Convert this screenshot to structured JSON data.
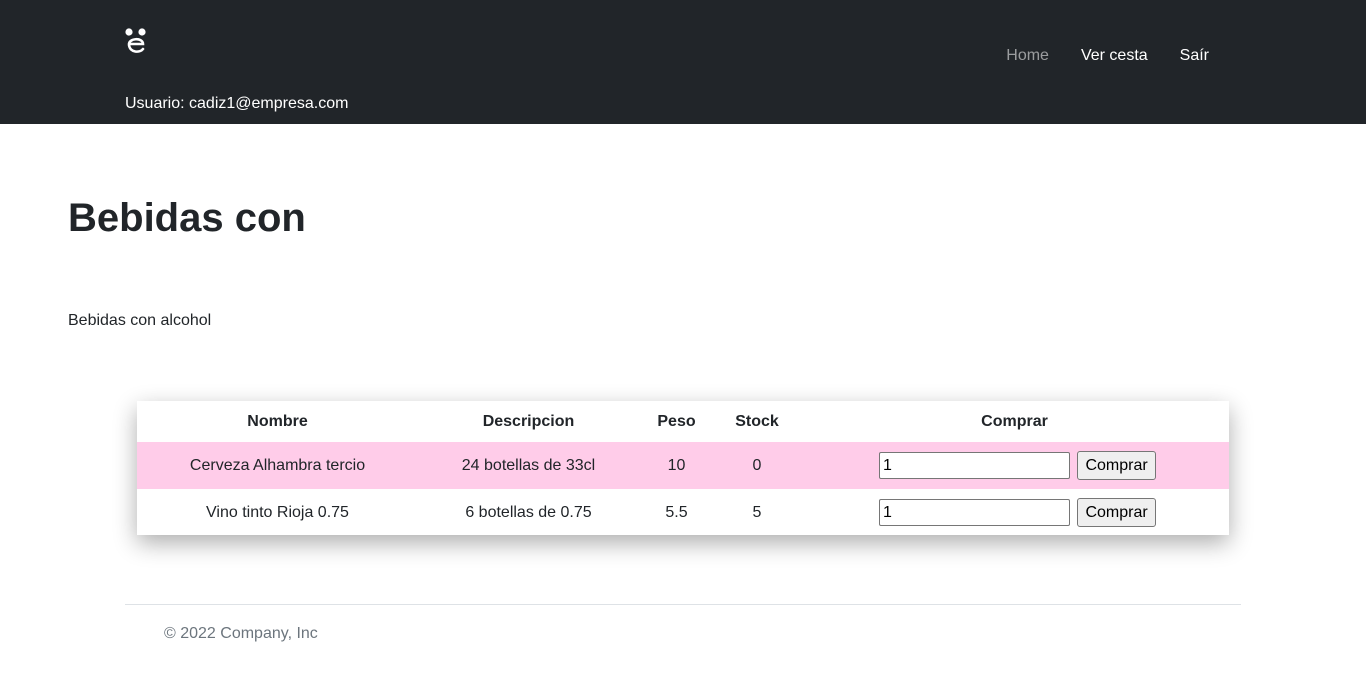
{
  "header": {
    "logo_icon": "mouse-e-logo-icon",
    "nav": [
      {
        "label": "Home",
        "state": "muted"
      },
      {
        "label": "Ver cesta",
        "state": "active"
      },
      {
        "label": "Saír",
        "state": "active"
      }
    ],
    "user_line": "Usuario: cadiz1@empresa.com"
  },
  "main": {
    "title": "Bebidas con",
    "description": "Bebidas con alcohol"
  },
  "table": {
    "headers": [
      "Nombre",
      "Descripcion",
      "Peso",
      "Stock",
      "Comprar"
    ],
    "rows": [
      {
        "nombre": "Cerveza Alhambra tercio",
        "descripcion": "24 botellas de 33cl",
        "peso": "10",
        "stock": "0",
        "cantidad": "1",
        "button_label": "Comprar"
      },
      {
        "nombre": "Vino tinto Rioja 0.75",
        "descripcion": "6 botellas de 0.75",
        "peso": "5.5",
        "stock": "5",
        "cantidad": "1",
        "button_label": "Comprar"
      }
    ]
  },
  "footer": {
    "text": "© 2022 Company, Inc"
  },
  "colors": {
    "navbar_bg": "#212529",
    "highlight_row": "#ffcce9",
    "muted_link": "#8c8e91"
  }
}
